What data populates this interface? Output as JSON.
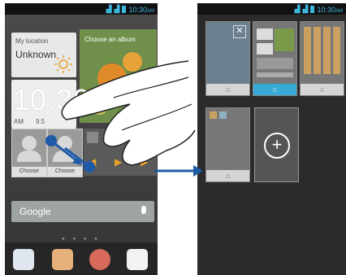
{
  "status": {
    "time": "10:30",
    "ampm": "AM"
  },
  "left": {
    "location_label": "My location",
    "location_value": "Unknown",
    "album_label": "Choose an album",
    "clock_time": "10:30",
    "clock_ampm": "AM",
    "clock_date": "9.5",
    "contact1_caption": "Choose",
    "contact2_caption": "Choose",
    "search_logo": "Google"
  },
  "colors": {
    "accent": "#36a9d6",
    "gesture_blue": "#1f5aa6"
  }
}
